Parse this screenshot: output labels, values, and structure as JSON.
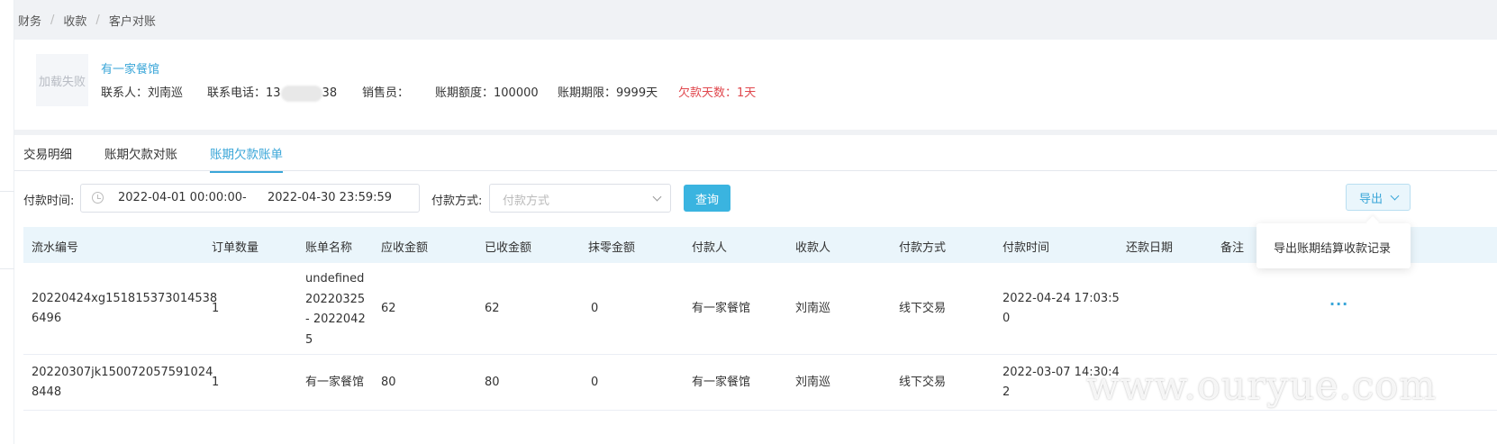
{
  "breadcrumb": [
    "财务",
    "收款",
    "客户对账"
  ],
  "customer": {
    "avatar_text": "加载失败",
    "name": "有一家餐馆",
    "contact_label": "联系人：刘南巡",
    "phone_prefix": "联系电话：13",
    "phone_suffix": "38",
    "salesperson_label": "销售员：",
    "credit_limit_label": "账期额度：100000",
    "credit_term_label": "账期期限：9999天",
    "overdue_label": "欠款天数：1天",
    "overdue_color": "#e0484e"
  },
  "tabs": [
    {
      "label": "交易明细"
    },
    {
      "label": "账期欠款对账"
    },
    {
      "label": "账期欠款账单"
    }
  ],
  "active_tab": 2,
  "filters": {
    "pay_time_label": "付款时间:",
    "date_start": "2022-04-01 00:00:00",
    "date_sep": "-",
    "date_end": "2022-04-30 23:59:59",
    "pay_method_label": "付款方式:",
    "pay_method_placeholder": "付款方式",
    "query_button": "查询",
    "export_button": "导出"
  },
  "export_menu": {
    "items": [
      "导出账期结算收款记录"
    ]
  },
  "table": {
    "headers": [
      "流水编号",
      "订单数量",
      "账单名称",
      "应收金额",
      "已收金额",
      "抹零金额",
      "付款人",
      "收款人",
      "付款方式",
      "付款时间",
      "还款日期",
      "备注"
    ],
    "rows": [
      {
        "serial": "20220424xg151815373014538\n6496",
        "order_count": "1",
        "bill_name": "undefined\n20220325\n- 2022042\n5",
        "receivable": "62",
        "received": "62",
        "rounding": "0",
        "payer": "有一家餐馆",
        "payee": "刘南巡",
        "pay_method": "线下交易",
        "pay_time": "2022-04-24 17:03:5\n0",
        "repay_date": "",
        "remark": ""
      },
      {
        "serial": "20220307jk150072057591024\n8448",
        "order_count": "1",
        "bill_name": "有一家餐馆",
        "receivable": "80",
        "received": "80",
        "rounding": "0",
        "payer": "有一家餐馆",
        "payee": "刘南巡",
        "pay_method": "线下交易",
        "pay_time": "2022-03-07 14:30:4\n2",
        "repay_date": "",
        "remark": ""
      }
    ],
    "more_icon": "more-horizontal-icon"
  },
  "watermark": "www.ouryue.com",
  "colors": {
    "accent": "#3aa6d8",
    "button": "#3ab4e0",
    "header_bg": "#eaf5fb"
  }
}
